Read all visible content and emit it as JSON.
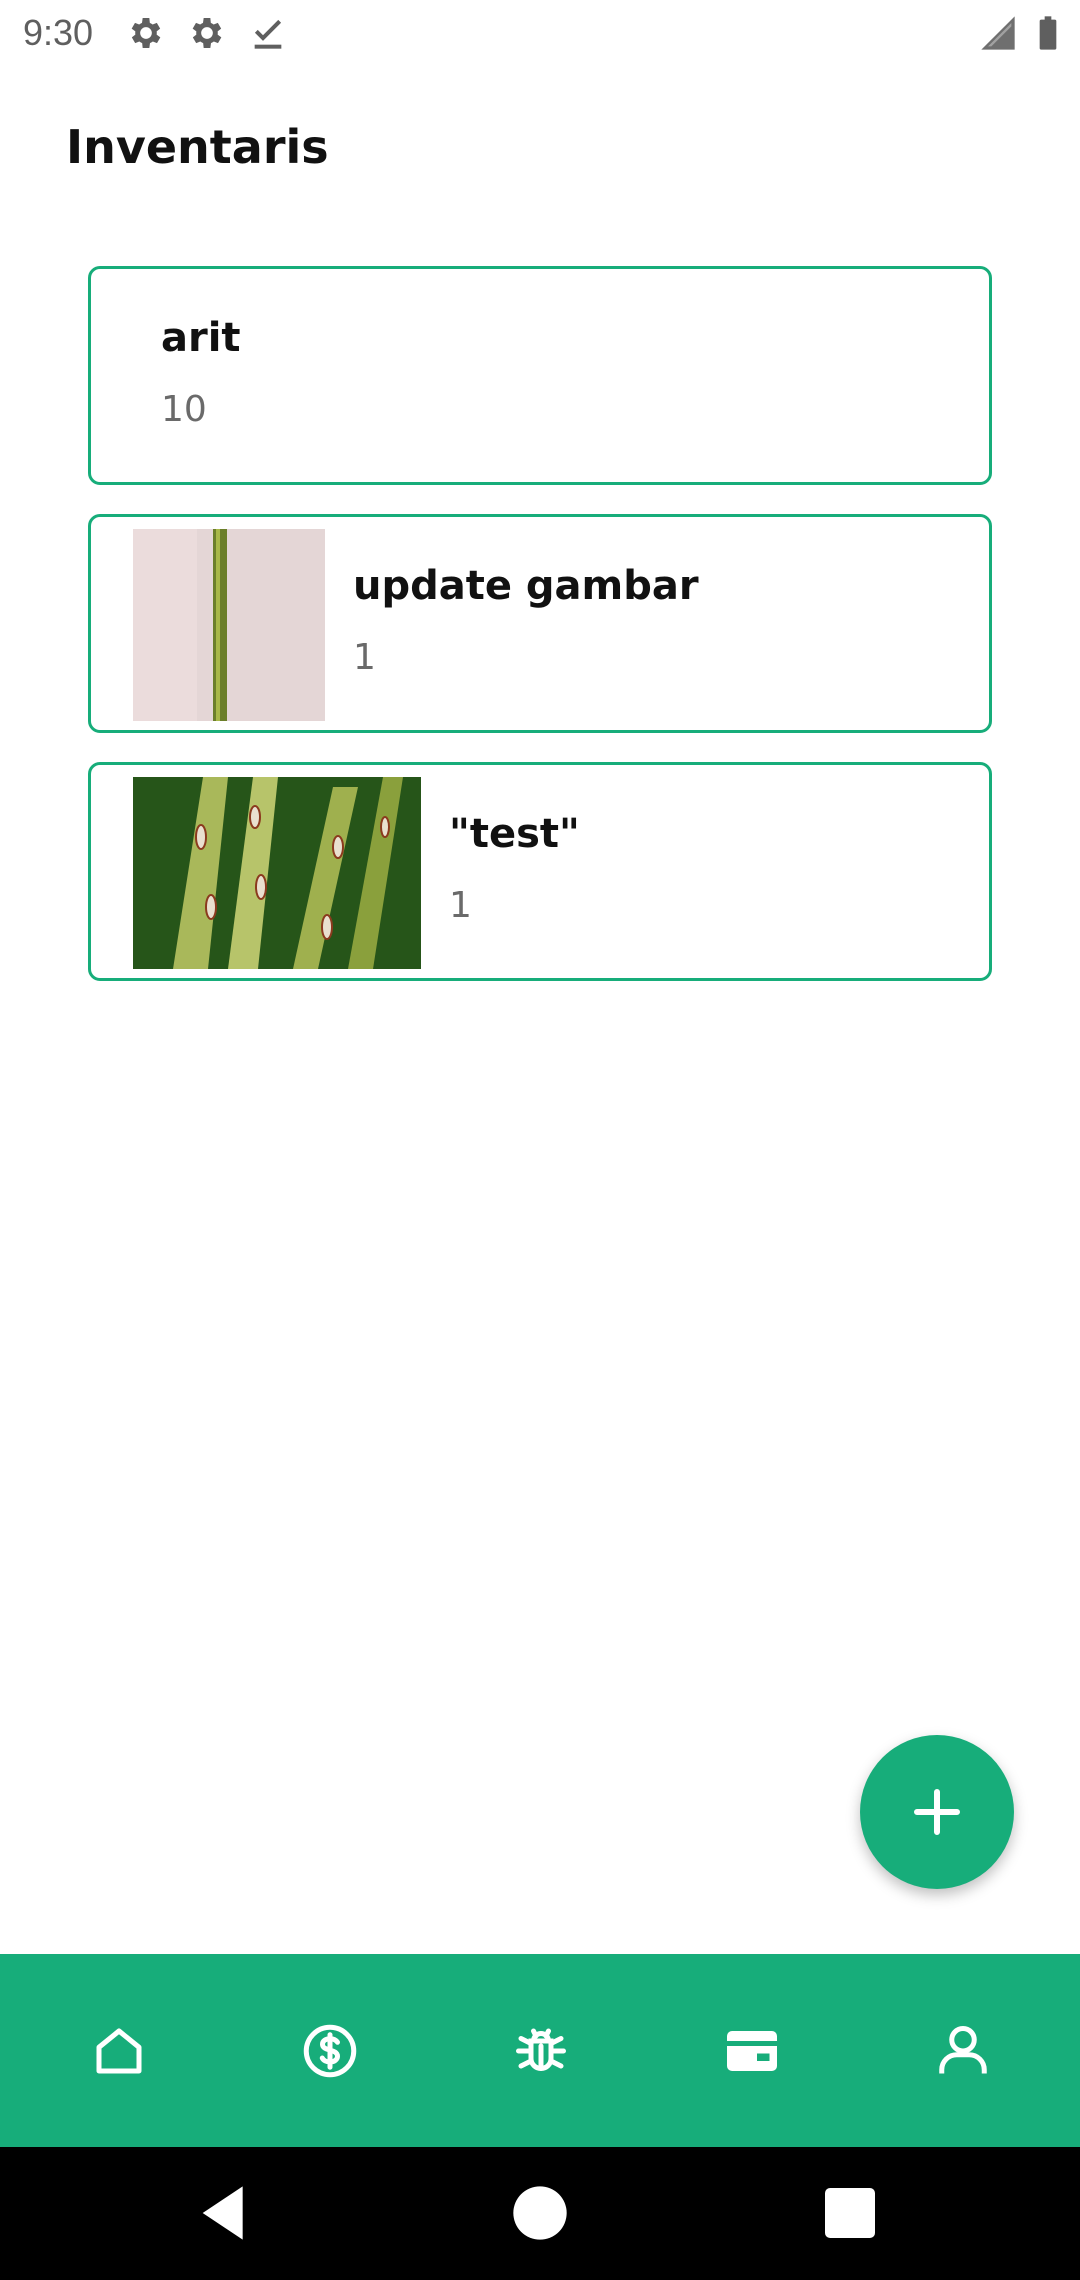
{
  "status_bar": {
    "time": "9:30",
    "icons": [
      "settings-icon",
      "settings-icon",
      "download-done-icon",
      "signal-icon",
      "battery-icon"
    ]
  },
  "page": {
    "title": "Inventaris"
  },
  "inventory": [
    {
      "name": "arit",
      "quantity": "10",
      "image": "none"
    },
    {
      "name": "update gambar",
      "quantity": "1",
      "image": "plant-stem-photo"
    },
    {
      "name": "\"test\"",
      "quantity": "1",
      "image": "leaf-disease-photo"
    }
  ],
  "fab": {
    "icon": "plus-icon"
  },
  "bottom_nav": {
    "items": [
      {
        "icon": "home-icon"
      },
      {
        "icon": "dollar-icon"
      },
      {
        "icon": "bug-icon"
      },
      {
        "icon": "wallet-icon"
      },
      {
        "icon": "person-icon"
      }
    ]
  },
  "colors": {
    "accent": "#17ad7a",
    "text": "#111111",
    "muted": "#6a6a6a"
  }
}
